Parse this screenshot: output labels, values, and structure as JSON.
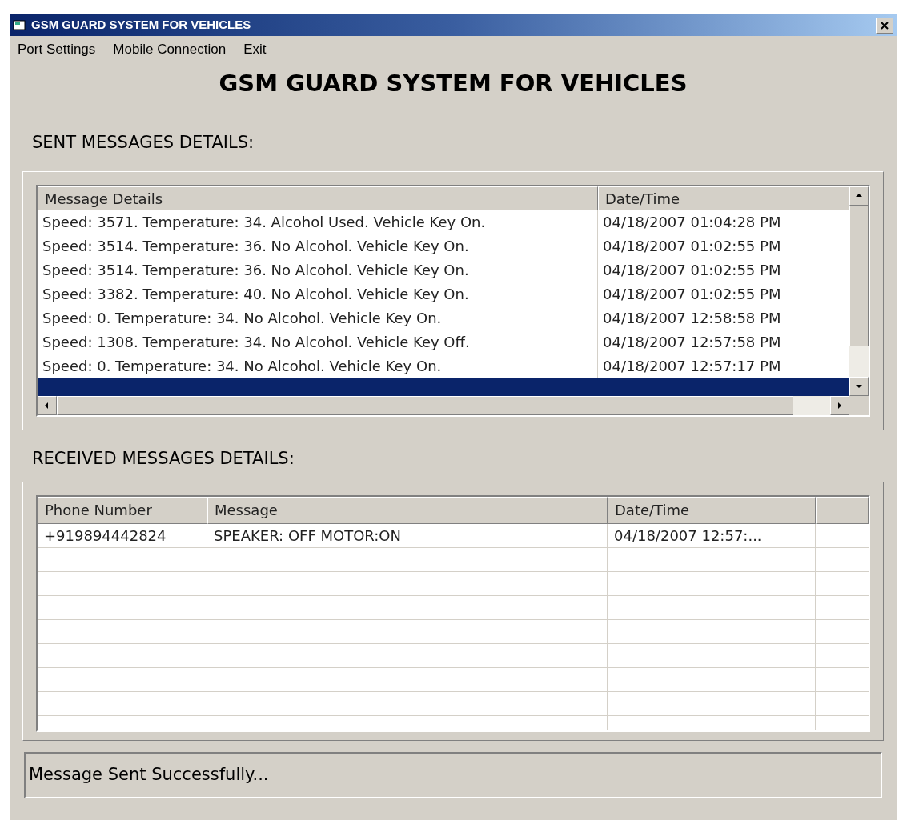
{
  "window": {
    "title": "GSM GUARD SYSTEM FOR VEHICLES"
  },
  "menu": [
    "Port Settings",
    "Mobile Connection",
    "Exit"
  ],
  "heading": "GSM GUARD SYSTEM FOR VEHICLES",
  "sent": {
    "label": "SENT MESSAGES DETAILS:",
    "columns": [
      "Message Details",
      "Date/Time"
    ],
    "rows": [
      {
        "cells": [
          "Speed: 3571. Temperature: 34. Alcohol Used. Vehicle Key On.",
          "04/18/2007 01:04:28 PM"
        ],
        "selected": false
      },
      {
        "cells": [
          "Speed: 3514. Temperature: 36. No Alcohol. Vehicle Key On.",
          "04/18/2007 01:02:55 PM"
        ],
        "selected": false
      },
      {
        "cells": [
          "Speed: 3514. Temperature: 36. No Alcohol. Vehicle Key On.",
          "04/18/2007 01:02:55 PM"
        ],
        "selected": false
      },
      {
        "cells": [
          "Speed: 3382. Temperature: 40. No Alcohol. Vehicle Key On.",
          "04/18/2007 01:02:55 PM"
        ],
        "selected": false
      },
      {
        "cells": [
          "Speed: 0. Temperature: 34. No Alcohol. Vehicle Key On.",
          "04/18/2007 12:58:58 PM"
        ],
        "selected": false
      },
      {
        "cells": [
          "Speed: 1308. Temperature: 34. No Alcohol. Vehicle Key Off.",
          "04/18/2007 12:57:58 PM"
        ],
        "selected": false
      },
      {
        "cells": [
          "Speed: 0. Temperature: 34. No Alcohol. Vehicle Key On.",
          "04/18/2007 12:57:17 PM"
        ],
        "selected": false
      },
      {
        "cells": [],
        "selected": true
      }
    ]
  },
  "received": {
    "label": "RECEIVED MESSAGES DETAILS:",
    "columns": [
      "Phone Number",
      "Message",
      "Date/Time"
    ],
    "rows": [
      {
        "cells": [
          "+919894442824",
          "SPEAKER: OFF MOTOR:ON",
          "04/18/2007 12:57:..."
        ]
      }
    ]
  },
  "status_bar": "Message Sent Successfully..."
}
